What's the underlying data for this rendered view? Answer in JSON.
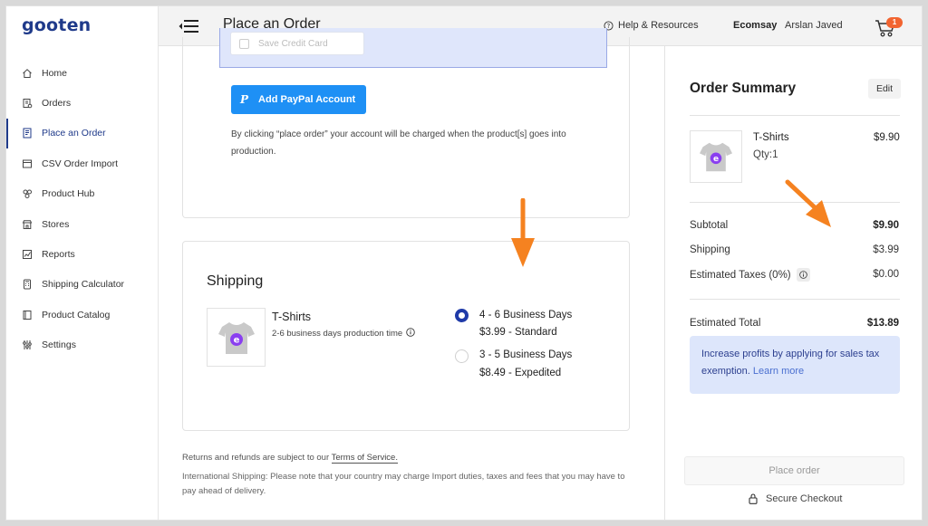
{
  "brand": {
    "logo": "gooten"
  },
  "sidebar": {
    "items": [
      {
        "label": "Home",
        "icon": "home-icon"
      },
      {
        "label": "Orders",
        "icon": "orders-icon"
      },
      {
        "label": "Place an Order",
        "icon": "place-order-icon",
        "active": true
      },
      {
        "label": "CSV Order Import",
        "icon": "csv-import-icon"
      },
      {
        "label": "Product Hub",
        "icon": "product-hub-icon"
      },
      {
        "label": "Stores",
        "icon": "stores-icon"
      },
      {
        "label": "Reports",
        "icon": "reports-icon"
      },
      {
        "label": "Shipping Calculator",
        "icon": "calculator-icon"
      },
      {
        "label": "Product Catalog",
        "icon": "catalog-icon"
      },
      {
        "label": "Settings",
        "icon": "settings-icon"
      }
    ]
  },
  "header": {
    "title": "Place an Order",
    "help": "Help & Resources",
    "store": "Ecomsay",
    "user": "Arslan Javed",
    "cart_count": "1"
  },
  "payment": {
    "save_card_label": "Save Credit Card",
    "paypal_button": "Add PayPal Account",
    "paypal_glyph": "P",
    "disclaimer": "By clicking “place order” your account will be charged when the product[s] goes into production."
  },
  "shipping": {
    "title": "Shipping",
    "product_name": "T-Shirts",
    "production_time": "2-6 business days production time",
    "options": [
      {
        "days": "4 - 6 Business Days",
        "price": "$3.99 - Standard",
        "selected": true
      },
      {
        "days": "3 - 5 Business Days",
        "price": "$8.49 - Expedited",
        "selected": false
      }
    ]
  },
  "footer_notes": {
    "returns_prefix": "Returns and refunds are subject to our ",
    "tos_link": "Terms of Service.",
    "international": "International Shipping: Please note that your country may charge Import duties, taxes and fees that you may have to pay ahead of delivery."
  },
  "summary": {
    "title": "Order Summary",
    "edit": "Edit",
    "product_name": "T-Shirts",
    "qty": "Qty:1",
    "product_price": "$9.90",
    "subtotal_label": "Subtotal",
    "subtotal": "$9.90",
    "shipping_label": "Shipping",
    "shipping": "$3.99",
    "tax_label": "Estimated Taxes (0%)",
    "tax": "$0.00",
    "total_label": "Estimated Total",
    "total": "$13.89",
    "tax_note": "Increase profits by applying for sales tax exemption.",
    "learn_more": "Learn more",
    "place_order": "Place order",
    "secure_checkout": "Secure Checkout"
  },
  "colors": {
    "brand_blue": "#1f3a8a",
    "paypal_blue": "#1e90f5",
    "accent_orange": "#f58220",
    "badge_orange": "#f26430",
    "info_bg": "#dde6fb"
  }
}
